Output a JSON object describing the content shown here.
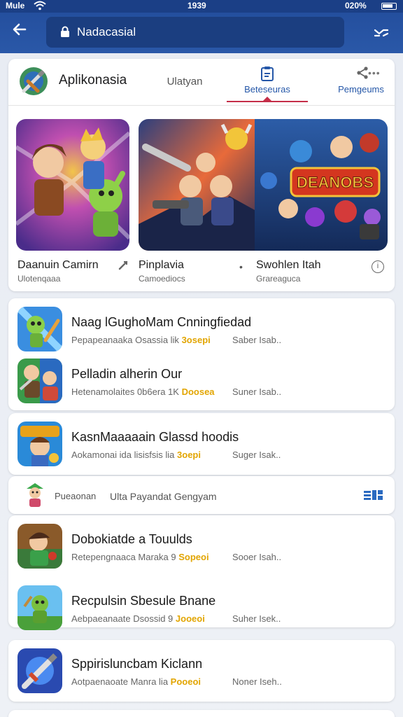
{
  "status": {
    "carrier": "Mule",
    "time": "1939",
    "battery": "020%"
  },
  "app_bar": {
    "url": "Nadacasial"
  },
  "featured": {
    "app_name": "Aplikonasia",
    "tabs": [
      {
        "label": "Ulatyan"
      },
      {
        "label": "Beteseuras"
      },
      {
        "label": "Pemgeums"
      }
    ],
    "tiles": [
      {
        "name": "Daanuin Camirn",
        "sub": "Ulotenqaaa"
      },
      {
        "name": "Pinplavia",
        "sub": "Camoediocs"
      },
      {
        "name": "Swohlen Itah",
        "sub": "Grareaguca"
      }
    ],
    "tile_2_banner": "DEANOBS"
  },
  "list_groups": [
    {
      "items": [
        {
          "title": "Naag lGughoMam Cnningfiedad",
          "meta": "Pepapeanaaka Osassia lik",
          "badge": "3osepi",
          "extra": "Saber Isab.."
        },
        {
          "title": "Pelladin alherin Our",
          "meta": "Hetenamolaites 0b6era 1K",
          "badge": "Doosea",
          "extra": "Suner Isab.."
        }
      ]
    },
    {
      "items": [
        {
          "title": "KasnMaaaaain Glassd hoodis",
          "meta": "Aokamonai ida lisisfsis lia",
          "badge": "3oepi",
          "extra": "Suger Isak.."
        }
      ]
    },
    {
      "items": [
        {
          "title": "Dobokiatde a Touulds",
          "meta": "Retepengnaaca Maraka 9",
          "badge": "Sopeoi",
          "extra": "Sooer Isah.."
        },
        {
          "title": "Recpulsin Sbesule Bnane",
          "meta": "Aebpaeanaate Dsossid 9",
          "badge": "Jooeoi",
          "extra": "Suher Isek.."
        }
      ]
    },
    {
      "items": [
        {
          "title": "Sppirisluncbam Kiclann",
          "meta": "Aotpaenaoate Manra lia",
          "badge": "Pooeoi",
          "extra": "Noner Iseh.."
        }
      ]
    }
  ],
  "promo": {
    "label": "Pueaonan",
    "text": "Ulta Payandat Gengyam",
    "grid_label": "≡■"
  },
  "colors": {
    "accent_blue": "#2557a8",
    "tab_underline": "#c42e48",
    "badge_yellow": "#e2a500",
    "app_bar": "#244f9e"
  }
}
